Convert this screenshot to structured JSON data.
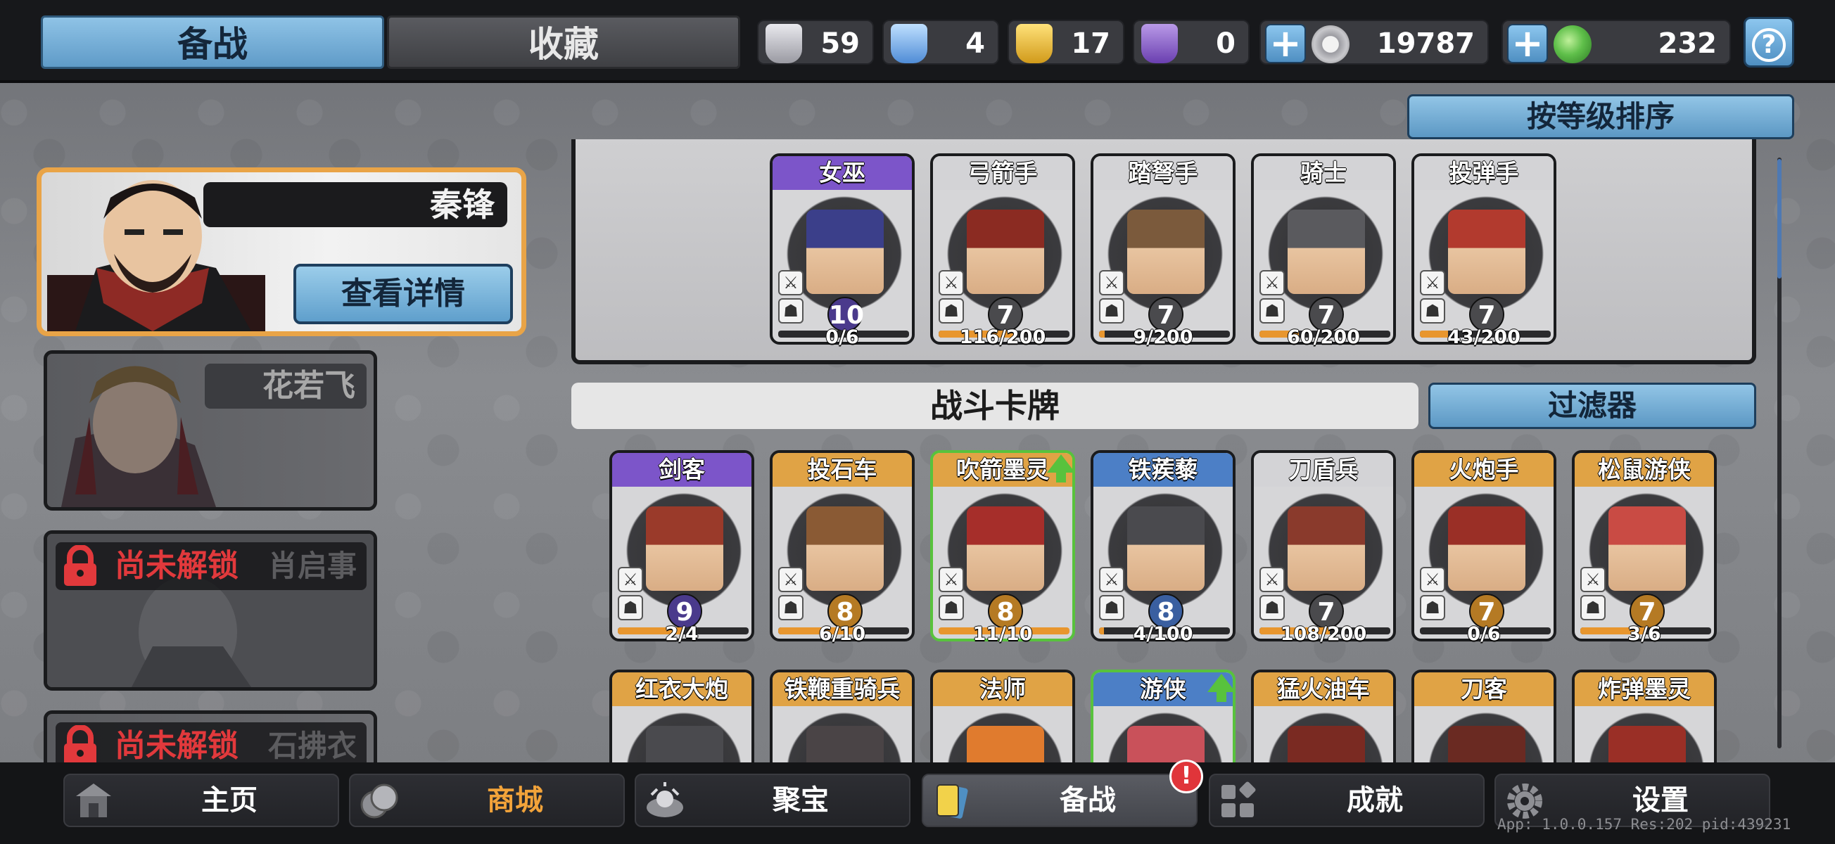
{
  "top_tabs": {
    "active": "备战",
    "inactive": "收藏"
  },
  "resources": [
    {
      "icon": "silver-shield-icon",
      "value": "59",
      "color": "#c9c9cf"
    },
    {
      "icon": "blue-shield-icon",
      "value": "4",
      "color": "#6aa9e6"
    },
    {
      "icon": "gold-shield-icon",
      "value": "17",
      "color": "#e5b42a"
    },
    {
      "icon": "purple-shield-icon",
      "value": "0",
      "color": "#8c5fd0"
    },
    {
      "icon": "silver-coin-icon",
      "value": "19787",
      "color": "#c4c4c8"
    },
    {
      "icon": "green-gem-icon",
      "value": "232",
      "color": "#5fbf4a"
    }
  ],
  "help_icon": "?",
  "sort_button": "按等级排序",
  "heroes": {
    "selected": {
      "name": "秦锋",
      "detail_button": "查看详情"
    },
    "second": {
      "name": "花若飞"
    },
    "locked": [
      {
        "lock_text": "尚未解锁",
        "name": "肖启事"
      },
      {
        "lock_text": "尚未解锁",
        "name": "石拂衣"
      }
    ]
  },
  "deck_cards": [
    {
      "name": "女巫",
      "level": "10",
      "progress": "0/6",
      "fill": 0.0,
      "header": "#7c55c9",
      "level_color": "#4a3a8c",
      "face": "#3b3f8a"
    },
    {
      "name": "弓箭手",
      "level": "7",
      "progress": "116/200",
      "fill": 0.58,
      "header": "#d3d3d6",
      "level_color": "#4a4a4d",
      "face": "#8b2b22"
    },
    {
      "name": "踏弩手",
      "level": "7",
      "progress": "9/200",
      "fill": 0.045,
      "header": "#d3d3d6",
      "level_color": "#4a4a4d",
      "face": "#7b5a3c"
    },
    {
      "name": "骑士",
      "level": "7",
      "progress": "60/200",
      "fill": 0.3,
      "header": "#d3d3d6",
      "level_color": "#4a4a4d",
      "face": "#5a5a5e"
    },
    {
      "name": "投弹手",
      "level": "7",
      "progress": "43/200",
      "fill": 0.215,
      "header": "#d3d3d6",
      "level_color": "#4a4a4d",
      "face": "#b23a2e"
    }
  ],
  "battle_cards_title": "战斗卡牌",
  "filter_button": "过滤器",
  "battle_cards": [
    {
      "name": "剑客",
      "level": "9",
      "progress": "2/4",
      "fill": 0.5,
      "header": "#7c55c9",
      "level_color": "#4a3a8c",
      "face": "#9a3a2a"
    },
    {
      "name": "投石车",
      "level": "8",
      "progress": "6/10",
      "fill": 0.6,
      "header": "#e0a345",
      "level_color": "#b57a24",
      "face": "#8a5a34"
    },
    {
      "name": "吹箭墨灵",
      "level": "8",
      "progress": "11/10",
      "fill": 1.0,
      "header": "#e0a345",
      "level_color": "#b57a24",
      "face": "#a62e2a",
      "upgrade": true
    },
    {
      "name": "铁蒺藜",
      "level": "8",
      "progress": "4/100",
      "fill": 0.04,
      "header": "#4c7fc6",
      "level_color": "#3a5fa0",
      "face": "#4a4a4e"
    },
    {
      "name": "刀盾兵",
      "level": "7",
      "progress": "108/200",
      "fill": 0.54,
      "header": "#d3d3d6",
      "level_color": "#4a4a4d",
      "face": "#8a3a2c"
    },
    {
      "name": "火炮手",
      "level": "7",
      "progress": "0/6",
      "fill": 0.0,
      "header": "#e0a345",
      "level_color": "#b57a24",
      "face": "#9a2f26"
    },
    {
      "name": "松鼠游侠",
      "level": "7",
      "progress": "3/6",
      "fill": 0.5,
      "header": "#e0a345",
      "level_color": "#b57a24",
      "face": "#c94b44"
    }
  ],
  "battle_cards_row2": [
    {
      "name": "红衣大炮",
      "header": "#e0a345",
      "face": "#4a4a4e"
    },
    {
      "name": "铁鞭重骑兵",
      "header": "#e0a345",
      "face": "#4a4446"
    },
    {
      "name": "法师",
      "header": "#e0a345",
      "face": "#e07b2e"
    },
    {
      "name": "游侠",
      "header": "#4c7fc6",
      "face": "#c9515a",
      "upgrade": true
    },
    {
      "name": "猛火油车",
      "header": "#e0a345",
      "face": "#7a2a22"
    },
    {
      "name": "刀客",
      "header": "#e0a345",
      "face": "#6a2a22"
    },
    {
      "name": "炸弹墨灵",
      "header": "#e0a345",
      "face": "#9a2f26"
    }
  ],
  "nav": [
    {
      "label": "主页",
      "icon": "home-icon"
    },
    {
      "label": "商城",
      "icon": "shop-coins-icon"
    },
    {
      "label": "聚宝",
      "icon": "treasure-icon"
    },
    {
      "label": "备战",
      "icon": "cards-icon"
    },
    {
      "label": "成就",
      "icon": "achievement-icon"
    },
    {
      "label": "设置",
      "icon": "gear-icon"
    }
  ],
  "notification": "!",
  "version": "App: 1.0.0.157 Res:202 pid:439231"
}
